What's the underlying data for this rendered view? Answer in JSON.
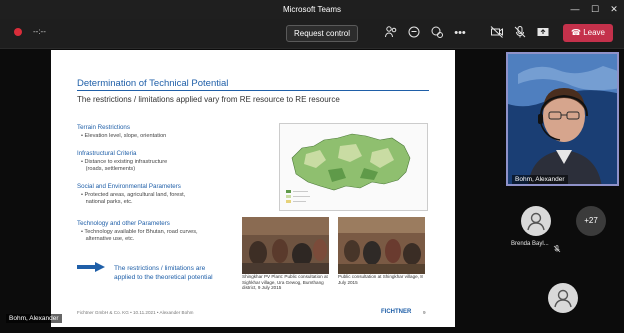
{
  "window": {
    "title": "Microsoft Teams",
    "controls": [
      "—",
      "☐",
      "✕"
    ]
  },
  "meeting": {
    "timer": "--:--",
    "request_control": "Request control",
    "leave": "Leave",
    "icons": [
      "people-icon",
      "chat-icon",
      "reactions-icon",
      "more-icon",
      "camera-off-icon",
      "mic-off-icon",
      "share-icon"
    ]
  },
  "slide": {
    "title": "Determination of Technical Potential",
    "subtitle": "The restrictions / limitations applied vary from RE resource to RE resource",
    "sections": [
      {
        "heading": "Terrain Restrictions",
        "body": "• Elevation level, slope, orientation"
      },
      {
        "heading": "Infrastructural Criteria",
        "body": "• Distance to existing infrastructure\n   (roads, settlements)"
      },
      {
        "heading": "Social and Environmental Parameters",
        "body": "• Protected areas, agricultural land, forest,\n   national parks, etc."
      },
      {
        "heading": "Technology and other Parameters",
        "body": "• Technology available for Bhutan, road curves,\n   alternative use, etc."
      }
    ],
    "conclusion": "The restrictions / limitations are applied to the theoretical potential",
    "captions": [
      "Shingkhar PV Plant: Public consultation at Sighkhar village, Ura Gewog, Bumthang district, 9 July 2015",
      "Public consultation at Shingkhar village, 8 July 2015"
    ],
    "footer": "Fichtner GmbH & Co. KG • 10.11.2021 • Alexander Bohm",
    "brand": "FICHTNER",
    "page": "9"
  },
  "participants": {
    "speaker": "Bohm, Alexander",
    "other": "Brenda Bayl...",
    "extra_count": "+27",
    "self_label": "Bohm, Alexander"
  }
}
